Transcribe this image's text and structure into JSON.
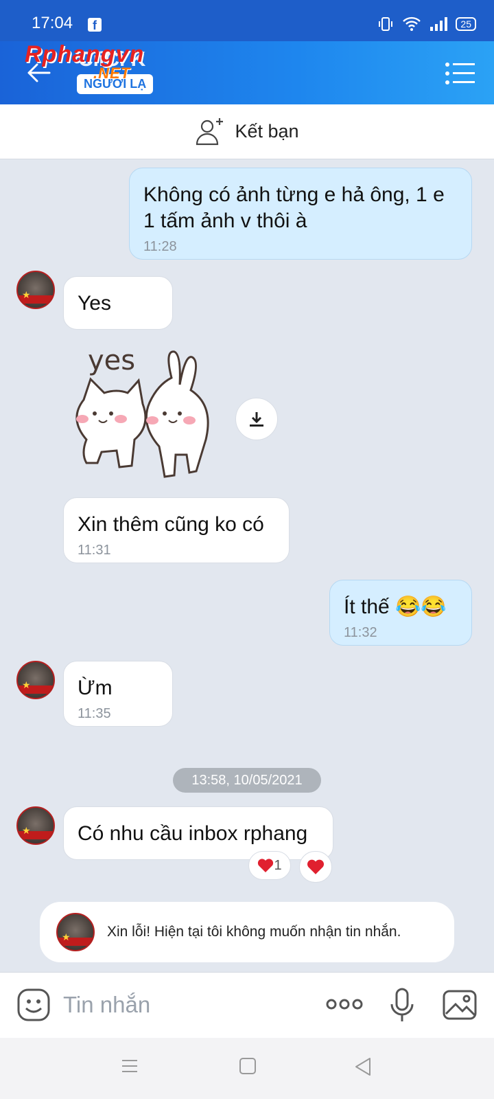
{
  "status_bar": {
    "time": "17:04",
    "battery": "25"
  },
  "header": {
    "contact_name": "CiiCi K",
    "stranger_label": "NGƯỜI LẠ",
    "watermark": "Rphangvn",
    "watermark_suffix": ".NET"
  },
  "add_friend": {
    "label": "Kết bạn"
  },
  "messages": [
    {
      "dir": "out",
      "text": "Không có ảnh từng e hả ông, 1 e 1 tấm ảnh v thôi à",
      "time": "11:28"
    },
    {
      "dir": "in",
      "text": "Yes",
      "time": ""
    },
    {
      "dir": "in",
      "text": "Xin thêm cũng ko có",
      "time": "11:31"
    },
    {
      "dir": "out",
      "text": "Ít thế 😂😂",
      "time": "11:32"
    },
    {
      "dir": "in",
      "text": "Ừm",
      "time": "11:35"
    },
    {
      "dir": "in",
      "text": "Có nhu cầu inbox rphang",
      "time": ""
    }
  ],
  "sticker": {
    "text": "yes"
  },
  "date_separator": "13:58, 10/05/2021",
  "reactions": {
    "count": "1"
  },
  "notice": {
    "text": "Xin lỗi! Hiện tại tôi không muốn nhận tin nhắn."
  },
  "input": {
    "placeholder": "Tin nhắn"
  },
  "colors": {
    "header": "#1e86ee",
    "outgoing_bubble": "#d5eeff",
    "incoming_bubble": "#ffffff",
    "chat_bg": "#e2e7ef",
    "heart": "#e0202f"
  }
}
